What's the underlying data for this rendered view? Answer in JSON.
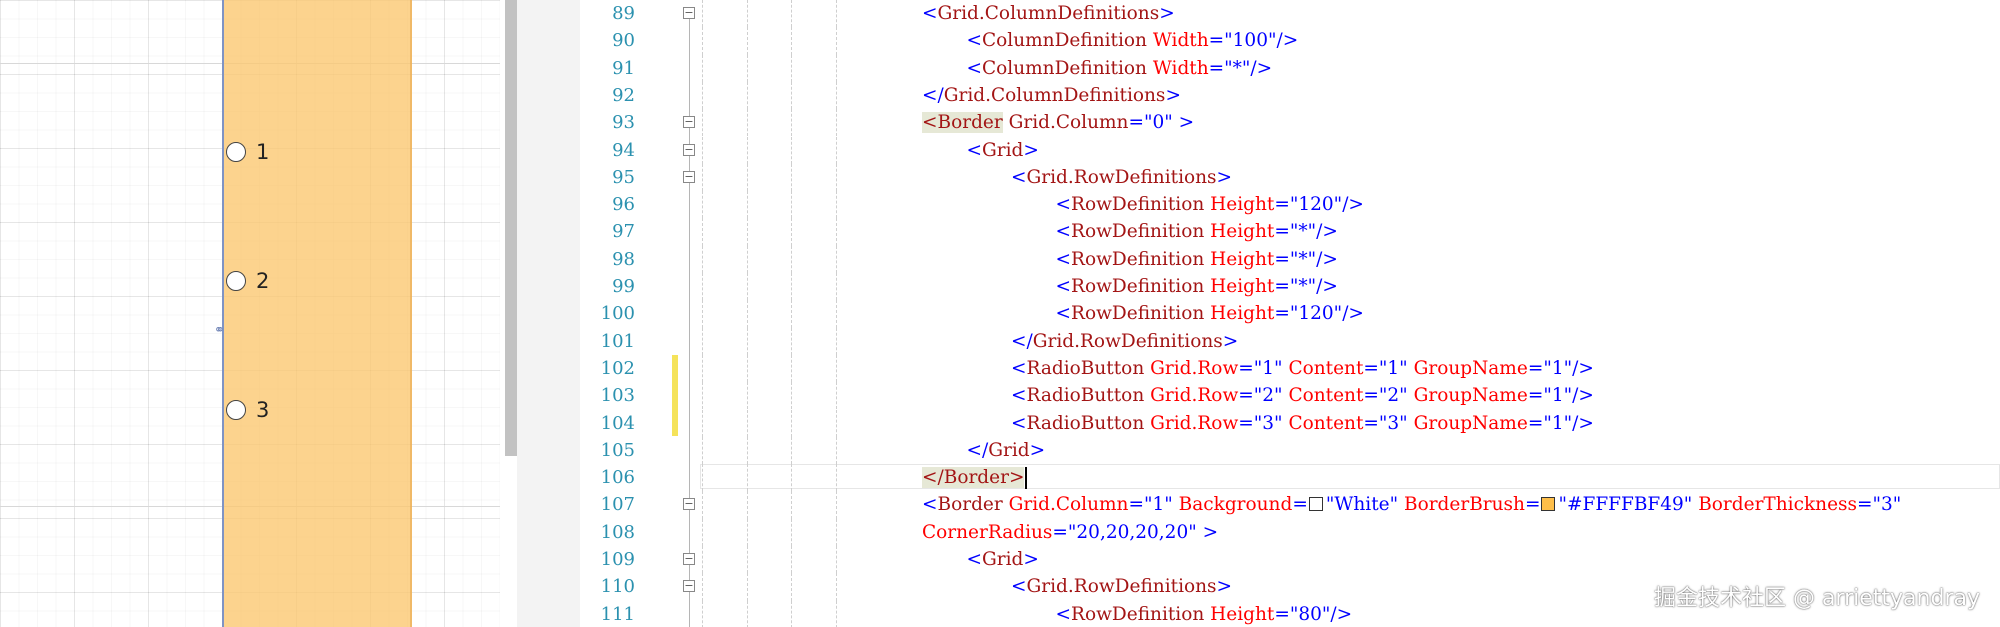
{
  "designer": {
    "radio_buttons": [
      {
        "label": "1"
      },
      {
        "label": "2"
      },
      {
        "label": "3"
      }
    ],
    "panel_color": "#FBC76E",
    "selection_color": "#7F93C4"
  },
  "editor": {
    "lines": [
      {
        "num": "89",
        "indent": 0,
        "tokens": [
          [
            "b",
            "<"
          ],
          [
            "r",
            "Grid.ColumnDefinitions"
          ],
          [
            "b",
            ">"
          ]
        ],
        "collapse": "−"
      },
      {
        "num": "90",
        "indent": 1,
        "tokens": [
          [
            "b",
            "<"
          ],
          [
            "r",
            "ColumnDefinition "
          ],
          [
            "a",
            "Width"
          ],
          [
            "b",
            "=\"100\"/>"
          ]
        ]
      },
      {
        "num": "91",
        "indent": 1,
        "tokens": [
          [
            "b",
            "<"
          ],
          [
            "r",
            "ColumnDefinition "
          ],
          [
            "a",
            "Width"
          ],
          [
            "b",
            "=\"*\"/>"
          ]
        ]
      },
      {
        "num": "92",
        "indent": 0,
        "tokens": [
          [
            "b",
            "</"
          ],
          [
            "r",
            "Grid.ColumnDefinitions"
          ],
          [
            "b",
            ">"
          ]
        ]
      },
      {
        "num": "93",
        "indent": 0,
        "tokens": [
          [
            "h",
            "<Border"
          ],
          [
            "r",
            " Grid.Column"
          ],
          [
            "b",
            "=\"0\" >"
          ]
        ],
        "collapse": "−"
      },
      {
        "num": "94",
        "indent": 1,
        "tokens": [
          [
            "b",
            "<"
          ],
          [
            "r",
            "Grid"
          ],
          [
            "b",
            ">"
          ]
        ],
        "collapse": "−"
      },
      {
        "num": "95",
        "indent": 2,
        "tokens": [
          [
            "b",
            "<"
          ],
          [
            "r",
            "Grid.RowDefinitions"
          ],
          [
            "b",
            ">"
          ]
        ],
        "collapse": "−"
      },
      {
        "num": "96",
        "indent": 3,
        "tokens": [
          [
            "b",
            "<"
          ],
          [
            "r",
            "RowDefinition "
          ],
          [
            "a",
            "Height"
          ],
          [
            "b",
            "=\"120\"/>"
          ]
        ]
      },
      {
        "num": "97",
        "indent": 3,
        "tokens": [
          [
            "b",
            "<"
          ],
          [
            "r",
            "RowDefinition "
          ],
          [
            "a",
            "Height"
          ],
          [
            "b",
            "=\"*\"/>"
          ]
        ]
      },
      {
        "num": "98",
        "indent": 3,
        "tokens": [
          [
            "b",
            "<"
          ],
          [
            "r",
            "RowDefinition "
          ],
          [
            "a",
            "Height"
          ],
          [
            "b",
            "=\"*\"/>"
          ]
        ]
      },
      {
        "num": "99",
        "indent": 3,
        "tokens": [
          [
            "b",
            "<"
          ],
          [
            "r",
            "RowDefinition "
          ],
          [
            "a",
            "Height"
          ],
          [
            "b",
            "=\"*\"/>"
          ]
        ]
      },
      {
        "num": "100",
        "indent": 3,
        "tokens": [
          [
            "b",
            "<"
          ],
          [
            "r",
            "RowDefinition "
          ],
          [
            "a",
            "Height"
          ],
          [
            "b",
            "=\"120\"/>"
          ]
        ]
      },
      {
        "num": "101",
        "indent": 2,
        "tokens": [
          [
            "b",
            "</"
          ],
          [
            "r",
            "Grid.RowDefinitions"
          ],
          [
            "b",
            ">"
          ]
        ]
      },
      {
        "num": "102",
        "indent": 2,
        "tokens": [
          [
            "b",
            "<"
          ],
          [
            "r",
            "RadioButton "
          ],
          [
            "a",
            "Grid.Row"
          ],
          [
            "b",
            "=\"1\" "
          ],
          [
            "a",
            "Content"
          ],
          [
            "b",
            "=\"1\" "
          ],
          [
            "a",
            "GroupName"
          ],
          [
            "b",
            "=\"1\"/>"
          ]
        ]
      },
      {
        "num": "103",
        "indent": 2,
        "tokens": [
          [
            "b",
            "<"
          ],
          [
            "r",
            "RadioButton "
          ],
          [
            "a",
            "Grid.Row"
          ],
          [
            "b",
            "=\"2\" "
          ],
          [
            "a",
            "Content"
          ],
          [
            "b",
            "=\"2\" "
          ],
          [
            "a",
            "GroupName"
          ],
          [
            "b",
            "=\"1\"/>"
          ]
        ]
      },
      {
        "num": "104",
        "indent": 2,
        "tokens": [
          [
            "b",
            "<"
          ],
          [
            "r",
            "RadioButton "
          ],
          [
            "a",
            "Grid.Row"
          ],
          [
            "b",
            "=\"3\" "
          ],
          [
            "a",
            "Content"
          ],
          [
            "b",
            "=\"3\" "
          ],
          [
            "a",
            "GroupName"
          ],
          [
            "b",
            "=\"1\"/>"
          ]
        ]
      },
      {
        "num": "105",
        "indent": 1,
        "tokens": [
          [
            "b",
            "</"
          ],
          [
            "r",
            "Grid"
          ],
          [
            "b",
            ">"
          ]
        ]
      },
      {
        "num": "106",
        "indent": 0,
        "tokens": [
          [
            "h",
            "</Border>"
          ]
        ],
        "caret": true
      },
      {
        "num": "107",
        "indent": 0,
        "tokens": [
          [
            "b",
            "<"
          ],
          [
            "r",
            "Border "
          ],
          [
            "a",
            "Grid.Column"
          ],
          [
            "b",
            "=\"1\" "
          ],
          [
            "a",
            "Background"
          ],
          [
            "b",
            "="
          ],
          [
            "sw",
            "#FFFFFF"
          ],
          [
            "b",
            "\"White\" "
          ],
          [
            "a",
            "BorderBrush"
          ],
          [
            "b",
            "="
          ],
          [
            "sw",
            "#FFBF49"
          ],
          [
            "b",
            "\"#FFFFBF49\" "
          ],
          [
            "a",
            "BorderThickness"
          ],
          [
            "b",
            "=\"3\""
          ]
        ],
        "collapse": "−"
      },
      {
        "num": "108",
        "indent": 0,
        "tokens": [
          [
            "a",
            "CornerRadius"
          ],
          [
            "b",
            "=\"20,20,20,20\" >"
          ]
        ]
      },
      {
        "num": "109",
        "indent": 1,
        "tokens": [
          [
            "b",
            "<"
          ],
          [
            "r",
            "Grid"
          ],
          [
            "b",
            ">"
          ]
        ],
        "collapse": "−"
      },
      {
        "num": "110",
        "indent": 2,
        "tokens": [
          [
            "b",
            "<"
          ],
          [
            "r",
            "Grid.RowDefinitions"
          ],
          [
            "b",
            ">"
          ]
        ],
        "collapse": "−"
      },
      {
        "num": "111",
        "indent": 3,
        "tokens": [
          [
            "b",
            "<"
          ],
          [
            "r",
            "RowDefinition "
          ],
          [
            "a",
            "Height"
          ],
          [
            "b",
            "=\"80\"/>"
          ]
        ]
      }
    ]
  },
  "watermark": "掘金技术社区 @ arriettyandray"
}
